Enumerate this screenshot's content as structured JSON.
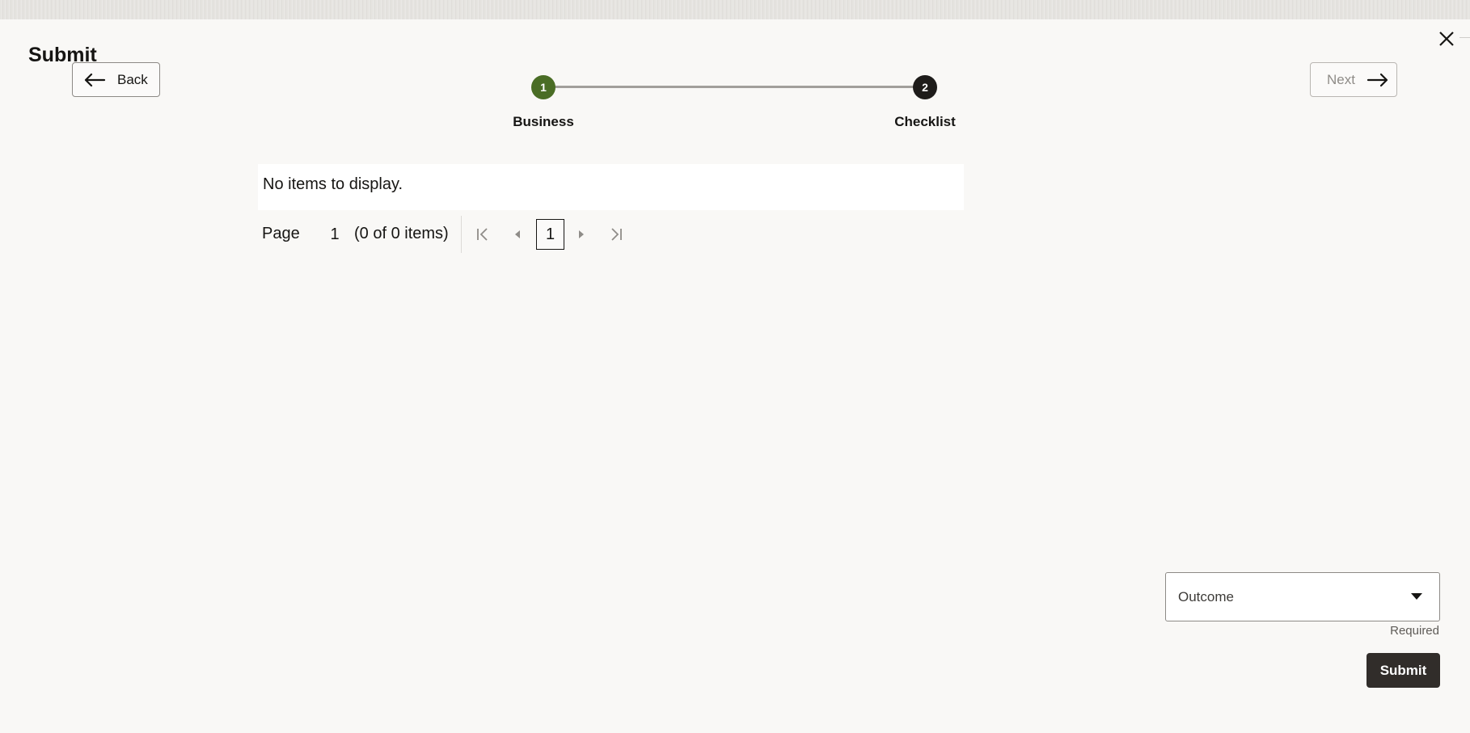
{
  "dialog": {
    "title": "Submit",
    "close_icon": "close-icon"
  },
  "navigation": {
    "back_label": "Back",
    "back_icon": "arrow-left-icon",
    "next_label": "Next",
    "next_icon": "arrow-right-icon",
    "next_enabled": false
  },
  "stepper": {
    "steps": [
      {
        "number": "1",
        "label": "Business",
        "state": "completed",
        "color": "#4a6d25"
      },
      {
        "number": "2",
        "label": "Checklist",
        "state": "current",
        "color": "#1e1c1a"
      }
    ]
  },
  "table": {
    "empty_message": "No items to display."
  },
  "pagination": {
    "page_label": "Page",
    "current_page": "1",
    "count_text": "(0 of 0 items)",
    "page_button": "1",
    "icons": [
      "first-page-icon",
      "previous-page-icon",
      "next-page-icon",
      "last-page-icon"
    ]
  },
  "outcome": {
    "placeholder": "Outcome",
    "required_text": "Required",
    "icon": "caret-down-icon"
  },
  "actions": {
    "submit_label": "Submit"
  },
  "colors": {
    "background": "#f9f8f6",
    "primary_button": "#312d2a",
    "step_complete": "#4a6d25"
  }
}
